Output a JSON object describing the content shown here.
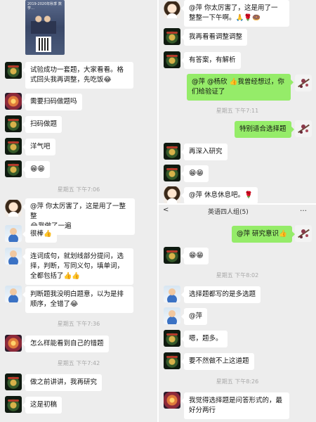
{
  "colors": {
    "background": "#ededed",
    "incoming_bubble": "#ffffff",
    "outgoing_bubble": "#95ec69",
    "timestamp": "#a8a8a8"
  },
  "left_top": {
    "poster_text": "2019-2020年秋季 数学…",
    "messages": [
      {
        "text": "试验成功一套题，大家看看。格式回头我再调整，先吃饭😂"
      },
      {
        "text": "需要扫码做题吗"
      },
      {
        "text": "扫码做题"
      },
      {
        "text": "洋气吧"
      },
      {
        "text": "😁😁"
      }
    ],
    "time": "星期五 下午7:06"
  },
  "left_bottom": {
    "messages": [
      {
        "text": "@萍 你太厉害了，这是用了一整整\n😂我做了一遍"
      },
      {
        "text": "很棒👍"
      },
      {
        "text": "连词成句，就划线部分提问，选择，判断，写同义句，填单词，全都包括了👍👍"
      },
      {
        "text": "判断题我没明白题意，以为是排顺序，全错了😂"
      },
      {
        "text": "怎么样能看到自己的错题"
      },
      {
        "text": "做之前讲讲，我再研究"
      },
      {
        "text": "这是初稿"
      }
    ],
    "times": [
      "星期五 下午7:36",
      "星期五 下午7:42"
    ]
  },
  "right_top": {
    "messages": [
      {
        "text": "@萍 你太厉害了，这是用了一整整一下午啊。🙏🌹🍩"
      },
      {
        "text": "我再看看调整调整"
      },
      {
        "text": "有答案，有解析"
      },
      {
        "text": "@萍 @杨欣 👍我曾经想过，你们给验证了"
      },
      {
        "text": "特别适合选择题"
      },
      {
        "text": "再深入研究"
      },
      {
        "text": "😁😁"
      },
      {
        "text": "@萍 休息休息吧。🌹"
      }
    ],
    "time": "星期五 下午7:11"
  },
  "right_bottom": {
    "header": {
      "back": "<",
      "title": "英语四人组(5)",
      "more": "…"
    },
    "messages": [
      {
        "text": "@萍 研究意识👍"
      },
      {
        "text": "😁😁"
      },
      {
        "text": "选择题都写的是多选题"
      },
      {
        "text": "@萍"
      },
      {
        "text": "嗯，题多。"
      },
      {
        "text": "要不然做不上这道题"
      },
      {
        "text": "我觉得选择题是问答形式的，最好分两行"
      }
    ],
    "times": [
      "星期五 下午8:02",
      "星期五 下午8:26"
    ]
  }
}
